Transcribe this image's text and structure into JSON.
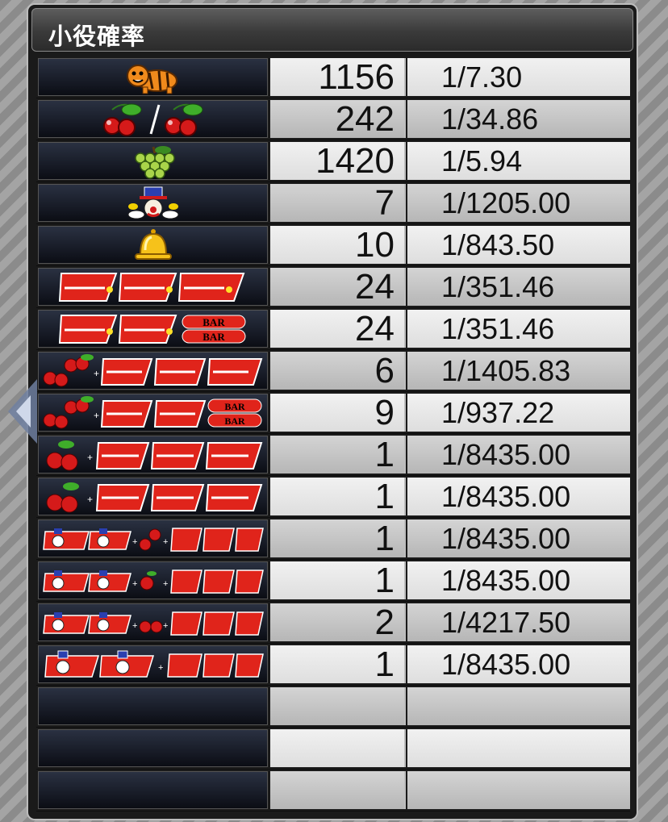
{
  "title": "小役確率",
  "rows": [
    {
      "icon": "tiger-icon",
      "count": "1156",
      "prob": "1/7.30"
    },
    {
      "icon": "cherry-slash-cherry-icon",
      "count": "242",
      "prob": "1/34.86"
    },
    {
      "icon": "grape-icon",
      "count": "1420",
      "prob": "1/5.94"
    },
    {
      "icon": "clown-icon",
      "count": "7",
      "prob": "1/1205.00"
    },
    {
      "icon": "bell-icon",
      "count": "10",
      "prob": "1/843.50"
    },
    {
      "icon": "red-seven-triple-icon",
      "count": "24",
      "prob": "1/351.46"
    },
    {
      "icon": "red-seven-double-bar-icon",
      "count": "24",
      "prob": "1/351.46",
      "bar_text": "BAR"
    },
    {
      "icon": "cherry-plus-seven-triple-icon",
      "count": "6",
      "prob": "1/1405.83"
    },
    {
      "icon": "cherry-plus-seven-bar-icon",
      "count": "9",
      "prob": "1/937.22",
      "bar_text": "BAR"
    },
    {
      "icon": "cherry-plus-seven-triple-icon-2",
      "count": "1",
      "prob": "1/8435.00"
    },
    {
      "icon": "cherry-plus-seven-triple-icon-3",
      "count": "1",
      "prob": "1/8435.00"
    },
    {
      "icon": "clown-seven-cherry-seven-icon",
      "count": "1",
      "prob": "1/8435.00"
    },
    {
      "icon": "clown-seven-cherry-seven-icon-2",
      "count": "1",
      "prob": "1/8435.00"
    },
    {
      "icon": "clown-seven-cherry-seven-icon-3",
      "count": "2",
      "prob": "1/4217.50"
    },
    {
      "icon": "clown-clown-seven-icon",
      "count": "1",
      "prob": "1/8435.00"
    },
    {
      "icon": "",
      "count": "",
      "prob": ""
    },
    {
      "icon": "",
      "count": "",
      "prob": ""
    },
    {
      "icon": "",
      "count": "",
      "prob": ""
    }
  ],
  "colors": {
    "seven_red": "#e0241b",
    "seven_outline": "#ffffff",
    "cherry": "#d51a1a",
    "grape": "#9ecb3a",
    "bell": "#f2b511"
  }
}
